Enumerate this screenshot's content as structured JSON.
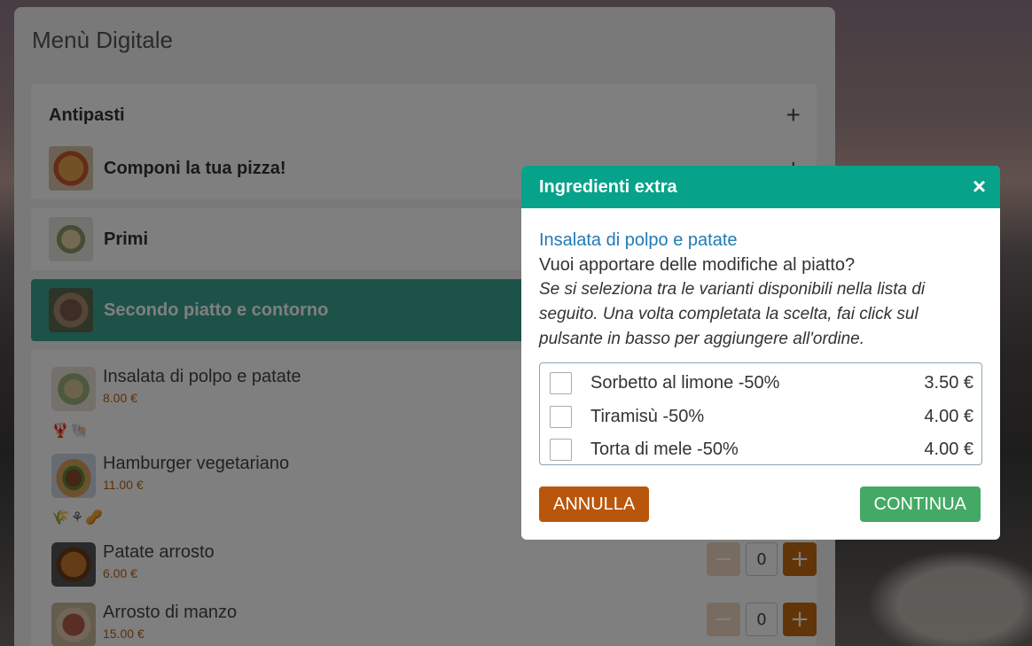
{
  "menu": {
    "title": "Menù Digitale",
    "categories": [
      {
        "label": "Antipasti",
        "toggle": "+",
        "icon": "plus-icon"
      },
      {
        "label": "Componi la tua pizza!",
        "toggle": "+",
        "icon": "plus-icon"
      },
      {
        "label": "Primi",
        "toggle": "",
        "icon": ""
      },
      {
        "label": "Secondo piatto e contorno",
        "toggle": "",
        "icon": ""
      }
    ],
    "items": [
      {
        "name": "Insalata di polpo e patate",
        "price": "8.00 €",
        "allergens": "🦞🐚"
      },
      {
        "name": "Hamburger vegetariano",
        "price": "11.00 €",
        "allergens": "🌾⚘🥜"
      },
      {
        "name": "Patate arrosto",
        "price": "6.00 €",
        "qty": "0",
        "minus": "−",
        "plus": "+"
      },
      {
        "name": "Arrosto di manzo",
        "price": "15.00 €",
        "qty": "0",
        "minus": "−",
        "plus": "+"
      }
    ]
  },
  "modal": {
    "title": "Ingredienti extra",
    "close": "×",
    "dish": "Insalata di polpo e patate",
    "question": "Vuoi apportare delle modifiche al piatto?",
    "instructions": "Se si seleziona tra le varianti disponibili nella lista di seguito. Una volta completata la scelta, fai click sul pulsante in basso per aggiungere all'ordine.",
    "options": [
      {
        "label": "Sorbetto al limone -50%",
        "price": "3.50 €"
      },
      {
        "label": "Tiramisù -50%",
        "price": "4.00 €"
      },
      {
        "label": "Torta di mele -50%",
        "price": "4.00 €"
      }
    ],
    "cancel": "ANNULLA",
    "continue": "CONTINUA"
  },
  "colors": {
    "accent": "#07a28a",
    "cancel": "#b9560c",
    "continue": "#44a965",
    "price": "#b4640d",
    "link": "#1f7bb6"
  }
}
